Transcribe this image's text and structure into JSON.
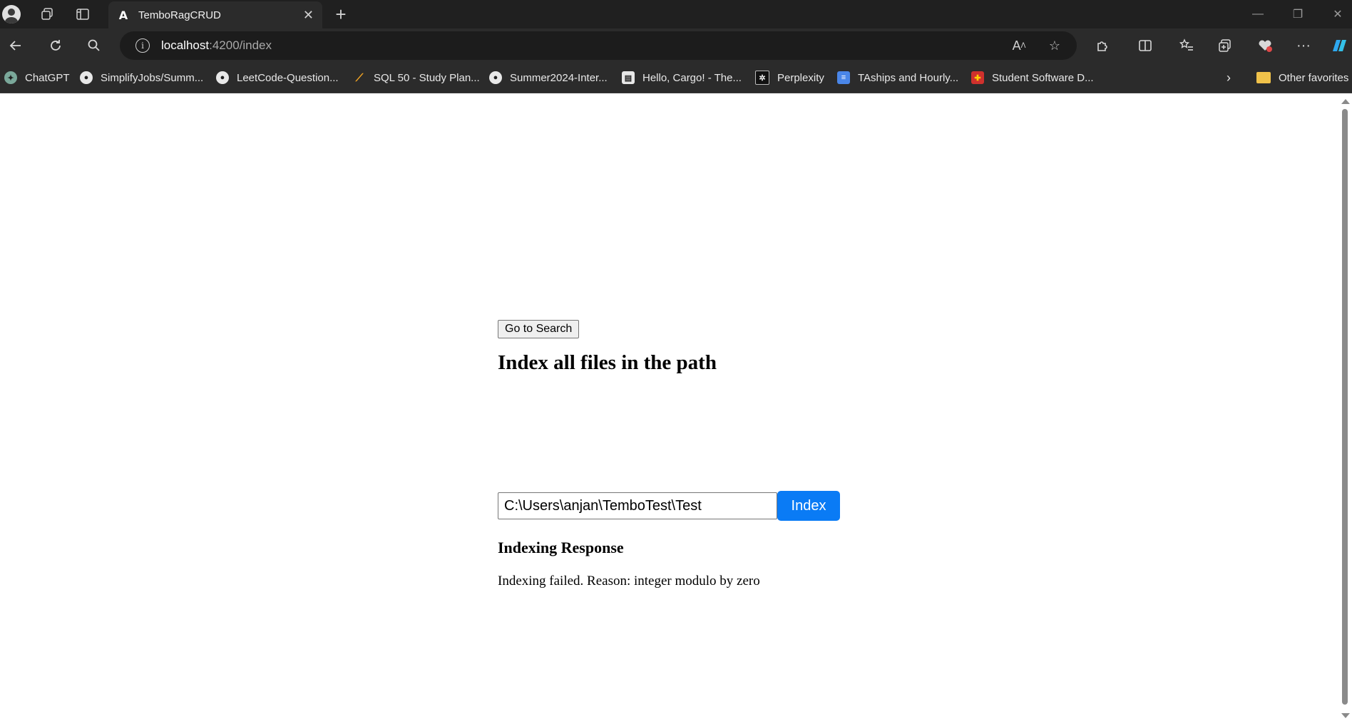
{
  "browser": {
    "tab_title": "TemboRagCRUD",
    "url_host": "localhost",
    "url_rest": ":4200/index",
    "bookmarks": [
      {
        "label": "ChatGPT",
        "icon": "chatgpt-icon"
      },
      {
        "label": "SimplifyJobs/Summ...",
        "icon": "github-icon"
      },
      {
        "label": "LeetCode-Question...",
        "icon": "github-icon"
      },
      {
        "label": "SQL 50 - Study Plan...",
        "icon": "leetcode-icon"
      },
      {
        "label": "Summer2024-Inter...",
        "icon": "github-icon"
      },
      {
        "label": "Hello, Cargo! - The...",
        "icon": "book-icon"
      },
      {
        "label": "Perplexity",
        "icon": "perplexity-icon"
      },
      {
        "label": "TAships and Hourly...",
        "icon": "docs-icon"
      },
      {
        "label": "Student Software D...",
        "icon": "umd-icon"
      }
    ],
    "other_favorites": "Other favorites"
  },
  "page": {
    "go_to_search_label": "Go to Search",
    "heading": "Index all files in the path",
    "path_value": "C:\\Users\\anjan\\TemboTest\\Test",
    "index_button_label": "Index",
    "response_heading": "Indexing Response",
    "response_text": "Indexing failed. Reason: integer modulo by zero"
  },
  "colors": {
    "index_button": "#0a7bf5",
    "chrome_dark": "#202020"
  }
}
